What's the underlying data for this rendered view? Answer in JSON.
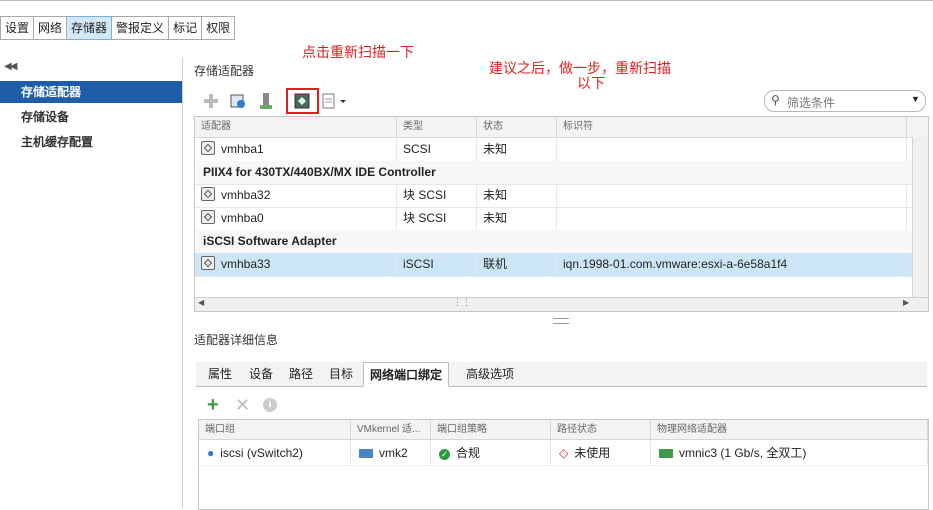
{
  "top_tabs": [
    "设置",
    "网络",
    "存储器",
    "警报定义",
    "标记",
    "权限"
  ],
  "sidebar": {
    "items": [
      "存储适配器",
      "存储设备",
      "主机缓存配置"
    ]
  },
  "section_title": "存储适配器",
  "filter_placeholder": "筛选条件",
  "annotations": {
    "rescan_hint": "点击重新扫描一下",
    "suggest_line1": "建议之后，做一步，重新扫描",
    "suggest_line2": "以下"
  },
  "adapters": {
    "columns": [
      "适配器",
      "类型",
      "状态",
      "标识符"
    ],
    "rows": [
      {
        "name": "vmhba1",
        "type": "SCSI",
        "status": "未知",
        "id": ""
      },
      {
        "group": "PIIX4 for 430TX/440BX/MX IDE Controller"
      },
      {
        "name": "vmhba32",
        "type": "块 SCSI",
        "status": "未知",
        "id": ""
      },
      {
        "name": "vmhba0",
        "type": "块 SCSI",
        "status": "未知",
        "id": ""
      },
      {
        "group": "iSCSI Software Adapter"
      },
      {
        "name": "vmhba33",
        "type": "iSCSI",
        "status": "联机",
        "id": "iqn.1998-01.com.vmware:esxi-a-6e58a1f4"
      }
    ]
  },
  "details_title": "适配器详细信息",
  "detail_tabs": [
    "属性",
    "设备",
    "路径",
    "目标",
    "网络端口绑定",
    "高级选项"
  ],
  "binding": {
    "columns": [
      "端口组",
      "VMkernel 适...",
      "端口组策略",
      "路径状态",
      "物理网络适配器"
    ],
    "row": {
      "port_group": "iscsi (vSwitch2)",
      "vmk": "vmk2",
      "policy": "合规",
      "path_state": "未使用",
      "nic": "vmnic3 (1 Gb/s, 全双工)"
    }
  },
  "colors": {
    "accent": "#1e5ea8",
    "selected_row": "#cde6f7",
    "annotation": "#e02020"
  }
}
